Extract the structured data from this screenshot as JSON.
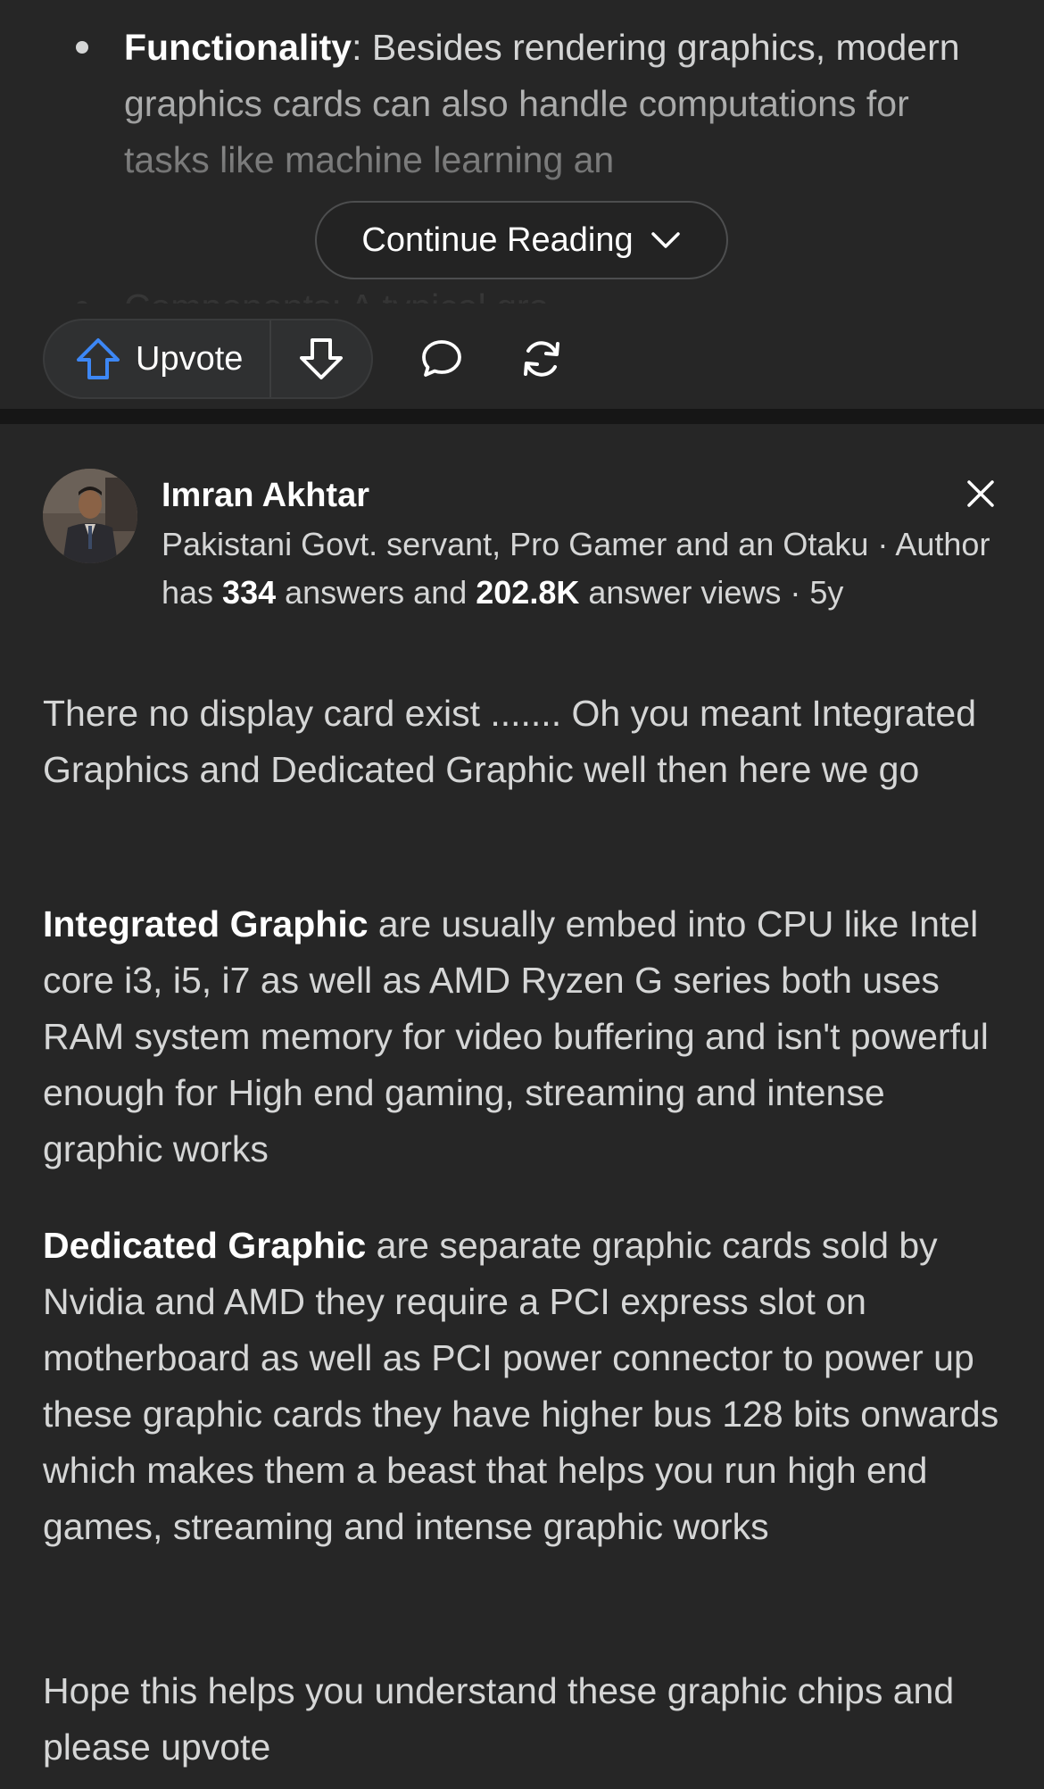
{
  "prev_answer": {
    "bullet1": {
      "term": "Functionality",
      "text": ": Besides rendering graphics, modern graphics cards can also handle computations for tasks like machine learning an"
    },
    "bullet2": {
      "text": "Components: A typical gra"
    },
    "continue_label": "Continue Reading",
    "upvote_label": "Upvote"
  },
  "answer": {
    "author_name": "Imran Akhtar",
    "credential_prefix": "Pakistani Govt. servant, Pro Gamer and an Otaku · Author has ",
    "answers_count": "334",
    "answers_mid": " answers and ",
    "views_count": "202.8K",
    "credential_suffix": " answer views · 5y",
    "paragraph1": "There no display card exist ....... Oh you meant Integrated Graphics and Dedicated Graphic well then here we go",
    "paragraph2_term": "Integrated Graphic",
    "paragraph2_text": " are usually embed into CPU like Intel core i3, i5, i7 as well as AMD Ryzen G series both uses RAM system memory for video buffering and isn't powerful enough for High end gaming, streaming and intense graphic works",
    "paragraph3_term": "Dedicated Graphic",
    "paragraph3_text": " are separate graphic cards sold by Nvidia and AMD they require a PCI express slot on motherboard as well as PCI power connector to power up these graphic cards they have higher bus 128 bits onwards which makes them a beast that helps you run high end games, streaming and intense graphic works",
    "paragraph4": "Hope this helps you understand these graphic chips and please upvote"
  },
  "colors": {
    "background": "#262626",
    "divider": "#161616",
    "text": "#d5d6d6",
    "upvote_accent": "#3d87f5"
  },
  "icons": [
    "chevron-down-icon",
    "upvote-arrow-icon",
    "downvote-arrow-icon",
    "comment-icon",
    "share-icon",
    "close-icon"
  ]
}
